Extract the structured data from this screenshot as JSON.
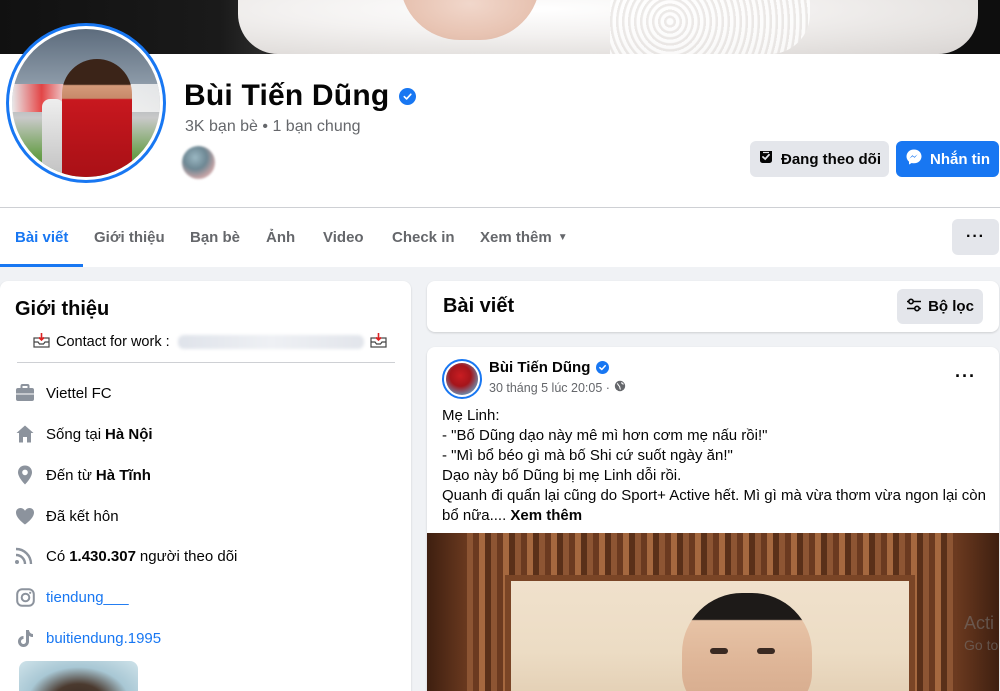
{
  "profile": {
    "name": "Bùi Tiến Dũng",
    "friends_summary": "3K bạn bè • 1 bạn chung"
  },
  "actions": {
    "follow_label": "Đang theo dõi",
    "message_label": "Nhắn tin"
  },
  "tabs": [
    {
      "label": "Bài viết",
      "active": true
    },
    {
      "label": "Giới thiệu"
    },
    {
      "label": "Bạn bè"
    },
    {
      "label": "Ảnh"
    },
    {
      "label": "Video"
    },
    {
      "label": "Check in"
    },
    {
      "label": "Xem thêm"
    }
  ],
  "intro": {
    "title": "Giới thiệu",
    "contact_label": "Contact for work :",
    "items": [
      {
        "icon": "briefcase-icon",
        "pre": "Viettel FC",
        "bold": "",
        "post": ""
      },
      {
        "icon": "home-icon",
        "pre": "Sống tại",
        "bold": "Hà Nội",
        "post": ""
      },
      {
        "icon": "location-pin-icon",
        "pre": "Đến từ",
        "bold": "Hà Tĩnh",
        "post": ""
      },
      {
        "icon": "heart-icon",
        "pre": "Đã kết hôn",
        "bold": "",
        "post": ""
      },
      {
        "icon": "followers-icon",
        "pre": "Có",
        "bold": "1.430.307",
        "post": "người theo dõi"
      },
      {
        "icon": "instagram-icon",
        "pre": "tiendung___",
        "bold": "",
        "post": ""
      },
      {
        "icon": "tiktok-icon",
        "pre": "buitiendung.1995",
        "bold": "",
        "post": ""
      }
    ]
  },
  "posts": {
    "title": "Bài viết",
    "filter_label": "Bộ lọc",
    "post": {
      "author": "Bùi Tiến Dũng",
      "time": "30 tháng 5 lúc 20:05 ·",
      "lines": [
        "Mẹ Linh:",
        "- \"Bố Dũng dạo này mê mì hơn cơm mẹ nấu rồi!\"",
        "- \"Mì bổ béo gì mà bố Shi cứ suốt ngày ăn!\"",
        "Dạo này bố Dũng bị mẹ Linh dỗi rồi.",
        "Quanh đi quẩn lại cũng do Sport+ Active hết. Mì gì mà vừa thơm vừa ngon lại còn"
      ],
      "last_line": "bổ nữa.... ",
      "see_more": "Xem thêm"
    }
  },
  "watermark": {
    "line1": "Acti",
    "line2": "Go to"
  },
  "colors": {
    "accent": "#1877f2",
    "secondary_text": "#65676b",
    "button_gray": "#e4e6eb",
    "page_bg": "#f0f2f5"
  }
}
